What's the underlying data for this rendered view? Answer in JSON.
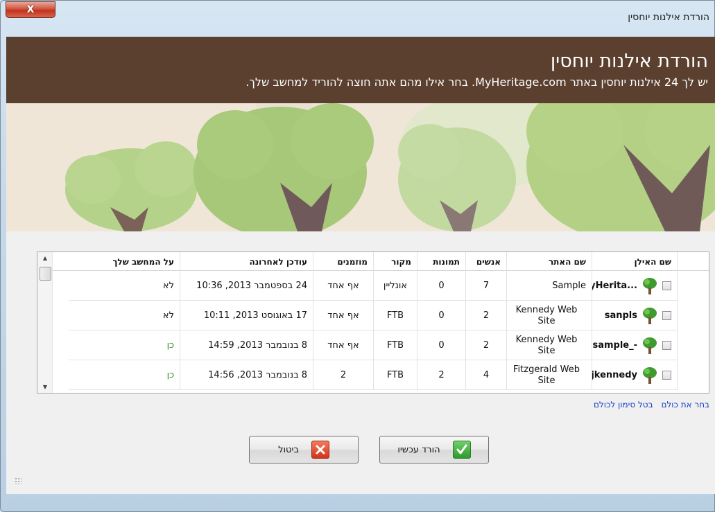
{
  "window": {
    "title": "הורדת אילנות יוחסין",
    "close_label": "X"
  },
  "header": {
    "title": "הורדת אילנות יוחסין",
    "subtitle": "יש לך 24 אילנות יוחסין באתר MyHeritage.com. בחר אילו מהם אתה חוצה להוריד למחשב שלך."
  },
  "table": {
    "columns": {
      "tree_name": "שם האילן",
      "site_name": "שם האתר",
      "people": "אנשים",
      "photos": "תמונות",
      "source": "מקור",
      "invited": "מוזמנים",
      "updated": "עודכן לאחרונה",
      "on_pc": "על המחשב שלך"
    },
    "rows": [
      {
        "tree_name": "...MyHerita",
        "site_name": "Sample",
        "people": "7",
        "photos": "0",
        "source": "אונליין",
        "invited": "אף אחד",
        "updated": "24 בספטמבר 2013, 10:36",
        "on_pc": "לא"
      },
      {
        "tree_name": "sanpls",
        "site_name": "Kennedy Web Site",
        "people": "2",
        "photos": "0",
        "source": "FTB",
        "invited": "אף אחד",
        "updated": "17 באוגוסט 2013, 10:11",
        "on_pc": "לא"
      },
      {
        "tree_name": "-_sample",
        "site_name": "Kennedy Web Site",
        "people": "2",
        "photos": "0",
        "source": "FTB",
        "invited": "אף אחד",
        "updated": "8 בנובמבר 2013, 14:59",
        "on_pc": "כן"
      },
      {
        "tree_name": "jkennedy",
        "site_name": "Fitzgerald Web Site",
        "people": "4",
        "photos": "2",
        "source": "FTB",
        "invited": "2",
        "updated": "8 בנובמבר 2013, 14:56",
        "on_pc": "כן"
      }
    ]
  },
  "links": {
    "select_all": "בחר את כולם",
    "deselect_all": "בטל סימון לכולם"
  },
  "buttons": {
    "download": "הורד עכשיו",
    "cancel": "ביטול"
  },
  "colors": {
    "header_bg": "#5b4030",
    "link": "#1a3ccc",
    "yes_text": "#2e8b1f"
  }
}
